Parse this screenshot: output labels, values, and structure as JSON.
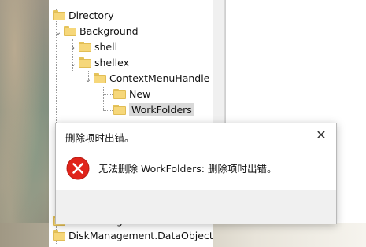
{
  "tree": {
    "items": [
      {
        "label": "Directory"
      },
      {
        "label": "Background"
      },
      {
        "label": "shell"
      },
      {
        "label": "shellex"
      },
      {
        "label": "ContextMenuHandle"
      },
      {
        "label": "New"
      },
      {
        "label": "WorkFolders"
      },
      {
        "label": "DiskManagement.Control"
      },
      {
        "label": "DiskManagement.DataObject"
      }
    ]
  },
  "dialog": {
    "title": "删除项时出错。",
    "message": "无法删除 WorkFolders: 删除项时出错。",
    "close_glyph": "✕",
    "icon": "error-icon"
  },
  "colors": {
    "error_red": "#e0241b",
    "folder_yellow": "#f6d77a",
    "selection_gray": "#d9d9d9",
    "footer_gray": "#f0f0f0"
  }
}
